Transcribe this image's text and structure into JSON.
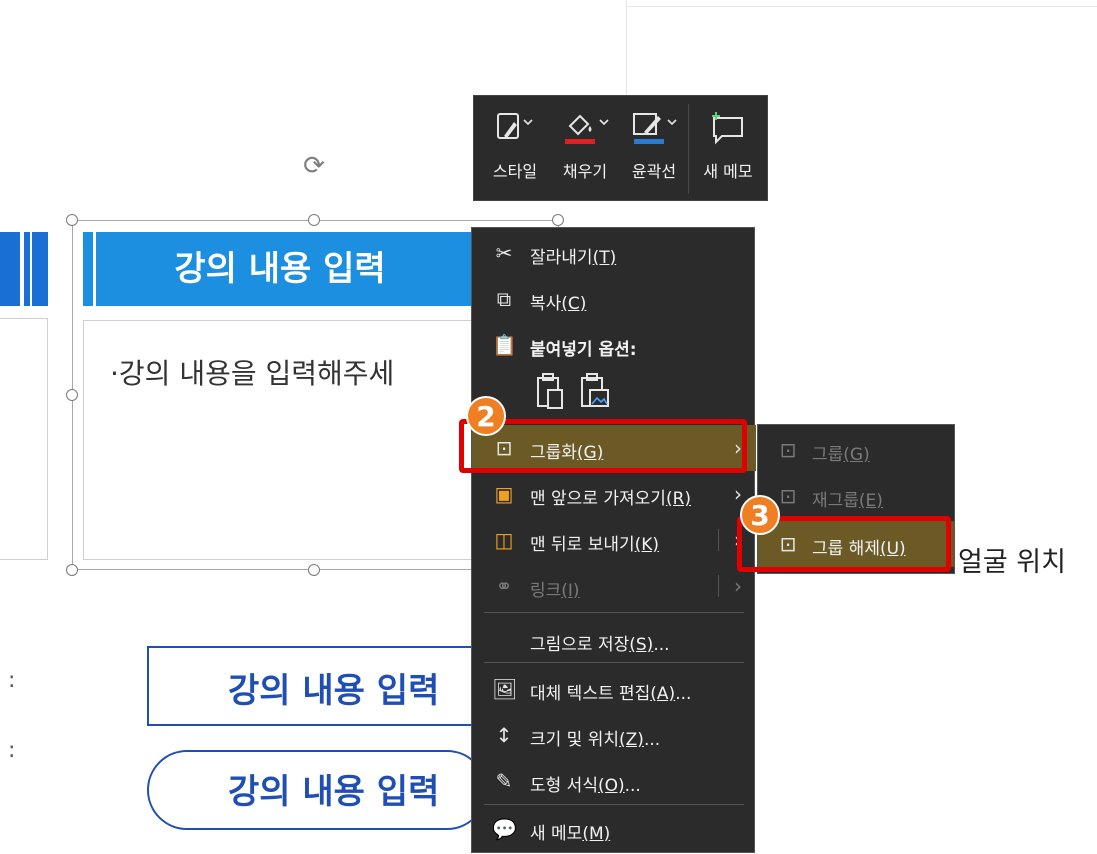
{
  "slide": {
    "title_text": "강의 내용 입력",
    "content_text": "·강의 내용을 입력해주세",
    "button_rect_text": "강의 내용 입력",
    "button_pill_text": "강의 내용 입력",
    "right_text": "얼굴 위치",
    "colors": {
      "title_blue": "#1c8fe0",
      "button_blue": "#1f4fb5",
      "left_blue": "#1a6fd4"
    }
  },
  "mini_toolbar": {
    "items": [
      {
        "label": "스타일",
        "icon": "style-icon"
      },
      {
        "label": "채우기",
        "icon": "fill-bucket-icon",
        "color": "#e02020"
      },
      {
        "label": "윤곽선",
        "icon": "outline-pen-icon",
        "color": "#2b7bd6"
      },
      {
        "label": "새 메모",
        "icon": "new-comment-icon"
      }
    ]
  },
  "context_menu": {
    "items": [
      {
        "label": "잘라내기",
        "hotkey": "(T)",
        "icon": "scissors-icon"
      },
      {
        "label": "복사",
        "hotkey": "(C)",
        "icon": "copy-icon"
      },
      {
        "label": "붙여넣기 옵션:",
        "icon": "paste-icon"
      },
      {
        "label": "그룹화",
        "hotkey": "(G)",
        "icon": "group-icon",
        "has_submenu": true
      },
      {
        "label": "맨 앞으로 가져오기",
        "hotkey": "(R)",
        "icon": "bring-to-front-icon",
        "has_submenu": true
      },
      {
        "label": "맨 뒤로 보내기",
        "hotkey": "(K)",
        "icon": "send-to-back-icon",
        "has_submenu": true
      },
      {
        "label": "링크",
        "hotkey": "(I)",
        "icon": "link-icon",
        "has_submenu": true,
        "disabled": true
      },
      {
        "label": "그림으로 저장",
        "hotkey": "(S)",
        "suffix": "..."
      },
      {
        "label": "대체 텍스트 편집",
        "hotkey": "(A)",
        "suffix": "...",
        "icon": "alt-text-icon"
      },
      {
        "label": "크기 및 위치",
        "hotkey": "(Z)",
        "suffix": "...",
        "icon": "size-position-icon"
      },
      {
        "label": "도형 서식",
        "hotkey": "(O)",
        "suffix": "...",
        "icon": "format-shape-icon"
      },
      {
        "label": "새 메모",
        "hotkey": "(M)",
        "icon": "new-comment-icon"
      }
    ]
  },
  "submenu": {
    "items": [
      {
        "label": "그룹",
        "hotkey": "(G)",
        "disabled": true,
        "icon": "group-icon"
      },
      {
        "label": "재그룹",
        "hotkey": "(E)",
        "disabled": true,
        "icon": "regroup-icon"
      },
      {
        "label": "그룹 해제",
        "hotkey": "(U)",
        "icon": "ungroup-icon"
      }
    ]
  },
  "annotations": {
    "step2": "2",
    "step3": "3",
    "highlight_color": "#e00000",
    "badge_color": "#f07e22"
  }
}
